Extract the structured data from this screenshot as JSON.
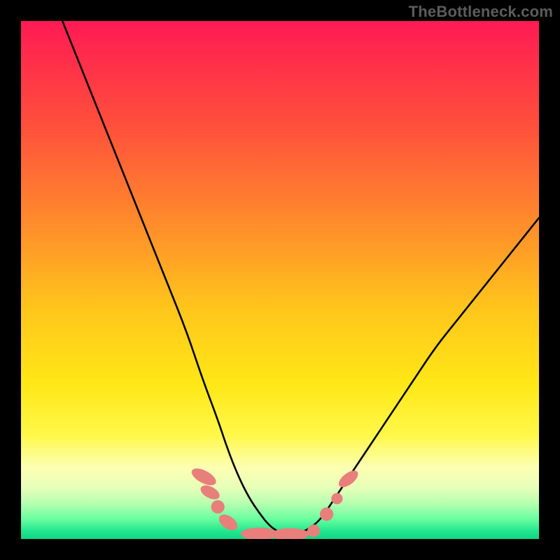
{
  "watermark": "TheBottleneck.com",
  "colors": {
    "stage_bg": "#000000",
    "curve_stroke": "#000000",
    "marker_fill": "#e97f7b",
    "marker_oblong": "#e97f7b",
    "gradient_stops": [
      {
        "offset": 0.0,
        "color": "#ff1a53"
      },
      {
        "offset": 0.2,
        "color": "#ff4f3c"
      },
      {
        "offset": 0.4,
        "color": "#ff8f2a"
      },
      {
        "offset": 0.55,
        "color": "#ffc41c"
      },
      {
        "offset": 0.7,
        "color": "#ffe716"
      },
      {
        "offset": 0.8,
        "color": "#fff84a"
      },
      {
        "offset": 0.86,
        "color": "#fdffb0"
      },
      {
        "offset": 0.9,
        "color": "#e8ffb8"
      },
      {
        "offset": 0.93,
        "color": "#b9ffb0"
      },
      {
        "offset": 0.96,
        "color": "#6cffa0"
      },
      {
        "offset": 0.985,
        "color": "#22e68f"
      },
      {
        "offset": 1.0,
        "color": "#0fd583"
      }
    ]
  },
  "chart_data": {
    "type": "line",
    "title": "",
    "xlabel": "",
    "ylabel": "",
    "xlim": [
      0,
      100
    ],
    "ylim": [
      0,
      100
    ],
    "grid": false,
    "legend": false,
    "description": "V-shaped bottleneck curve: 100 at x≈8 descending to ≈0 at x≈45–55, rising to ≈62 at x≈100. Y-axis inverted visually (0 at bottom = green = good).",
    "series": [
      {
        "name": "bottleneck_curve",
        "x": [
          8,
          12,
          16,
          20,
          24,
          28,
          32,
          35,
          38,
          40,
          42,
          44,
          46,
          48,
          50,
          52,
          54,
          56,
          58,
          60,
          64,
          68,
          72,
          76,
          80,
          84,
          88,
          92,
          96,
          100
        ],
        "y": [
          100,
          90,
          80,
          70,
          60,
          50,
          40,
          31,
          23,
          17,
          12,
          8,
          5,
          2.5,
          1.2,
          1.0,
          1.2,
          2.2,
          4,
          7,
          13,
          19,
          25,
          31,
          37,
          42,
          47,
          52,
          57,
          62
        ]
      }
    ],
    "markers": [
      {
        "shape": "oblong",
        "x": 35.3,
        "y": 12.0,
        "rx": 1.2,
        "ry": 2.6,
        "rot": -62
      },
      {
        "shape": "oblong",
        "x": 36.5,
        "y": 9.0,
        "rx": 1.1,
        "ry": 2.0,
        "rot": -62
      },
      {
        "shape": "circle",
        "x": 38.0,
        "y": 6.2,
        "r": 1.3
      },
      {
        "shape": "oblong",
        "x": 40.0,
        "y": 3.2,
        "rx": 1.2,
        "ry": 2.0,
        "rot": -55
      },
      {
        "shape": "oblong",
        "x": 46.0,
        "y": 1.0,
        "rx": 3.6,
        "ry": 1.2,
        "rot": 0
      },
      {
        "shape": "oblong",
        "x": 52.0,
        "y": 0.9,
        "rx": 3.6,
        "ry": 1.2,
        "rot": 0
      },
      {
        "shape": "circle",
        "x": 56.5,
        "y": 1.6,
        "r": 1.2
      },
      {
        "shape": "circle",
        "x": 59.0,
        "y": 4.8,
        "r": 1.3
      },
      {
        "shape": "circle",
        "x": 61.0,
        "y": 7.8,
        "r": 1.1
      },
      {
        "shape": "oblong",
        "x": 63.2,
        "y": 11.6,
        "rx": 1.1,
        "ry": 2.2,
        "rot": 52
      }
    ]
  }
}
